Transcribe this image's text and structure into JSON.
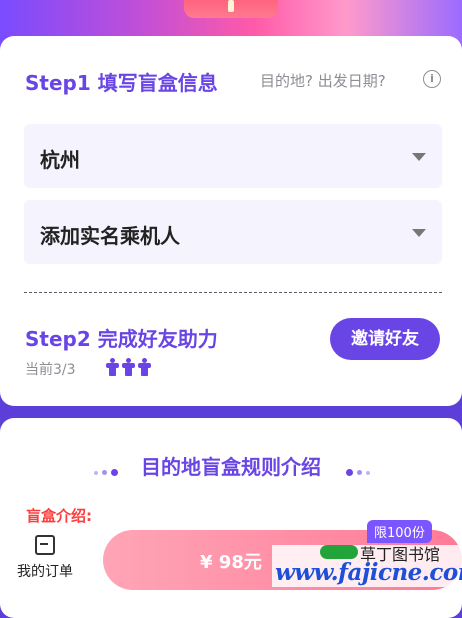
{
  "step1": {
    "title": "Step1 填写盲盒信息",
    "hint": "目的地? 出发日期?",
    "info_icon": "ⓘ",
    "destination_value": "杭州",
    "passenger_value": "添加实名乘机人"
  },
  "step2": {
    "title": "Step2 完成好友助力",
    "progress": "当前3/3",
    "helpers_current": 3,
    "helpers_total": 3,
    "invite_label": "邀请好友"
  },
  "rules": {
    "title": "目的地盲盒规则介绍",
    "intro_partial": "盲盒介绍:"
  },
  "bottom": {
    "orders_label": "我的订单",
    "price": "¥ 98元",
    "limit_badge": "限100份"
  },
  "watermark": {
    "top_text": "草丁图书馆",
    "url": "www.fajicne.com"
  },
  "colors": {
    "accent": "#6a45e6",
    "background": "#5b3fd8",
    "buy_button": "#ff8aa3"
  }
}
